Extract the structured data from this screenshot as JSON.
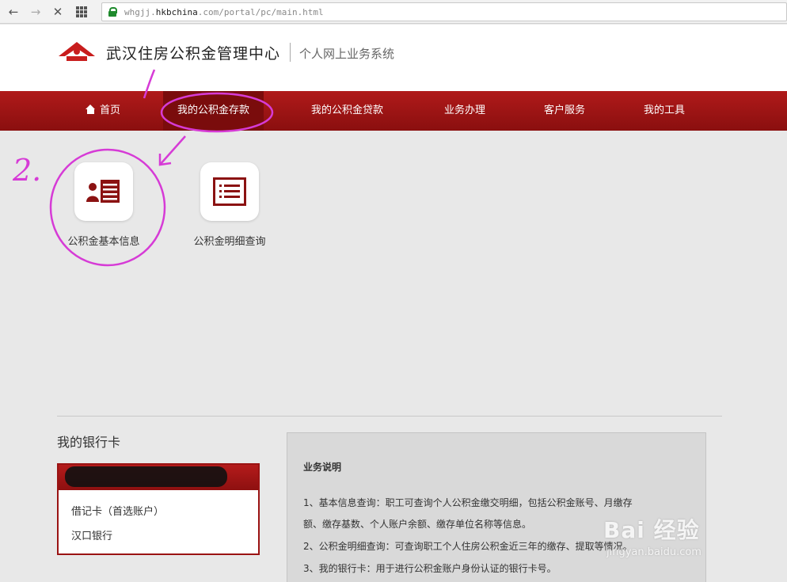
{
  "browser": {
    "url_prefix": "whgjj.",
    "url_domain": "hkbchina",
    "url_suffix": ".com/portal/pc/main.html"
  },
  "header": {
    "site_title": "武汉住房公积金管理中心",
    "subtitle": "个人网上业务系统"
  },
  "nav": {
    "items": [
      {
        "label": "首页"
      },
      {
        "label": "我的公积金存款"
      },
      {
        "label": "我的公积金贷款"
      },
      {
        "label": "业务办理"
      },
      {
        "label": "客户服务"
      },
      {
        "label": "我的工具"
      }
    ]
  },
  "tiles": [
    {
      "label": "公积金基本信息",
      "icon": "user-card-icon"
    },
    {
      "label": "公积金明细查询",
      "icon": "list-icon"
    }
  ],
  "bank": {
    "heading": "我的银行卡",
    "card_type": "借记卡（首选账户）",
    "bank_name": "汉口银行"
  },
  "info": {
    "title": "业务说明",
    "lines": [
      "1、基本信息查询：职工可查询个人公积金缴交明细，包括公积金账号、月缴存",
      "额、缴存基数、个人账户余额、缴存单位名称等信息。",
      "2、公积金明细查询：可查询职工个人住房公积金近三年的缴存、提取等情况。",
      "3、我的银行卡：用于进行公积金账户身份认证的银行卡号。"
    ]
  },
  "annotations": {
    "mark_1": "1.",
    "mark_2": "2."
  },
  "watermark": {
    "brand": "Bai 经验",
    "sub": "jingyan.baidu.com"
  },
  "colors": {
    "brand_red": "#a31515",
    "annotation": "#d63bd6"
  }
}
